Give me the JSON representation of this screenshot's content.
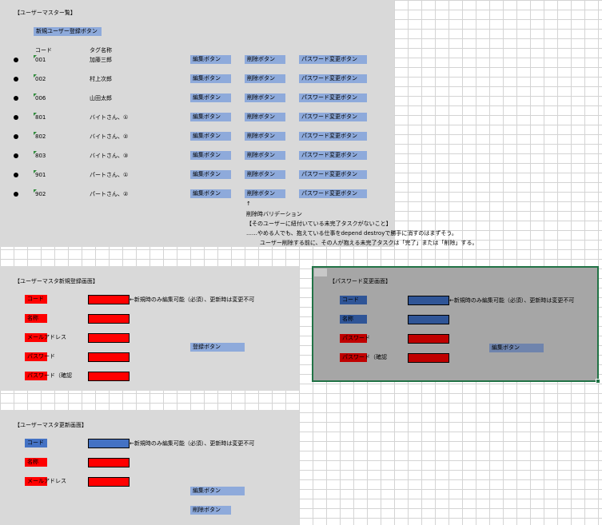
{
  "list": {
    "title": "【ユーザーマスター覧】",
    "new_user_button": "新規ユーザー登録ボタン",
    "col_code": "コード",
    "col_name": "タグ名称",
    "edit_label": "編集ボタン",
    "delete_label": "削除ボタン",
    "password_label": "パスワード変更ボタン",
    "rows": [
      {
        "code": "001",
        "name": "加藤三郎"
      },
      {
        "code": "002",
        "name": "村上次郎"
      },
      {
        "code": "006",
        "name": "山田太郎"
      },
      {
        "code": "801",
        "name": "バイトさん、①"
      },
      {
        "code": "802",
        "name": "バイトさん、②"
      },
      {
        "code": "803",
        "name": "バイトさん、③"
      },
      {
        "code": "901",
        "name": "パートさん、①"
      },
      {
        "code": "902",
        "name": "パートさん、②"
      }
    ],
    "note_arrow": "↑",
    "note_1": "削除時バリデーション",
    "note_2": "【そのユーザーに紐付いている未完了タスクがないこと】",
    "note_3": "……やめる人でも、抱えている仕事をdepend destroyで勝手に消すのはまずそう。",
    "note_4": "ユーザー削除する前に、その人が抱える未完了タスクは「完了」または「削除」する。"
  },
  "register": {
    "title": "【ユーザーマスタ新規登録画面】",
    "code_label": "コード",
    "name_label": "名称",
    "email_label": "メールアドレス",
    "password_label": "パスワード",
    "password_confirm_label": "パスワード（確認",
    "note": "←新規時のみ編集可能（必須）、更新時は変更不可",
    "submit_button": "登録ボタン"
  },
  "password": {
    "title": "【パスワード変更画面】",
    "code_label": "コード",
    "name_label": "名称",
    "password_label": "パスワード",
    "password_confirm_label": "パスワード（確認",
    "note": "←新規時のみ編集可能（必須）、更新時は変更不可",
    "edit_button": "編集ボタン"
  },
  "update": {
    "title": "【ユーザーマスタ更新画面】",
    "code_label": "コード",
    "name_label": "名称",
    "email_label": "メールアドレス",
    "note": "←新規時のみ編集可能（必須）、更新時は変更不可",
    "edit_button": "編集ボタン",
    "delete_button": "削除ボタン"
  },
  "colors": {
    "panel": "#d9d9d9",
    "button": "#8eaadb",
    "required_field": "#ff0000",
    "readonly_field": "#4472c4",
    "selection_border": "#217346"
  }
}
